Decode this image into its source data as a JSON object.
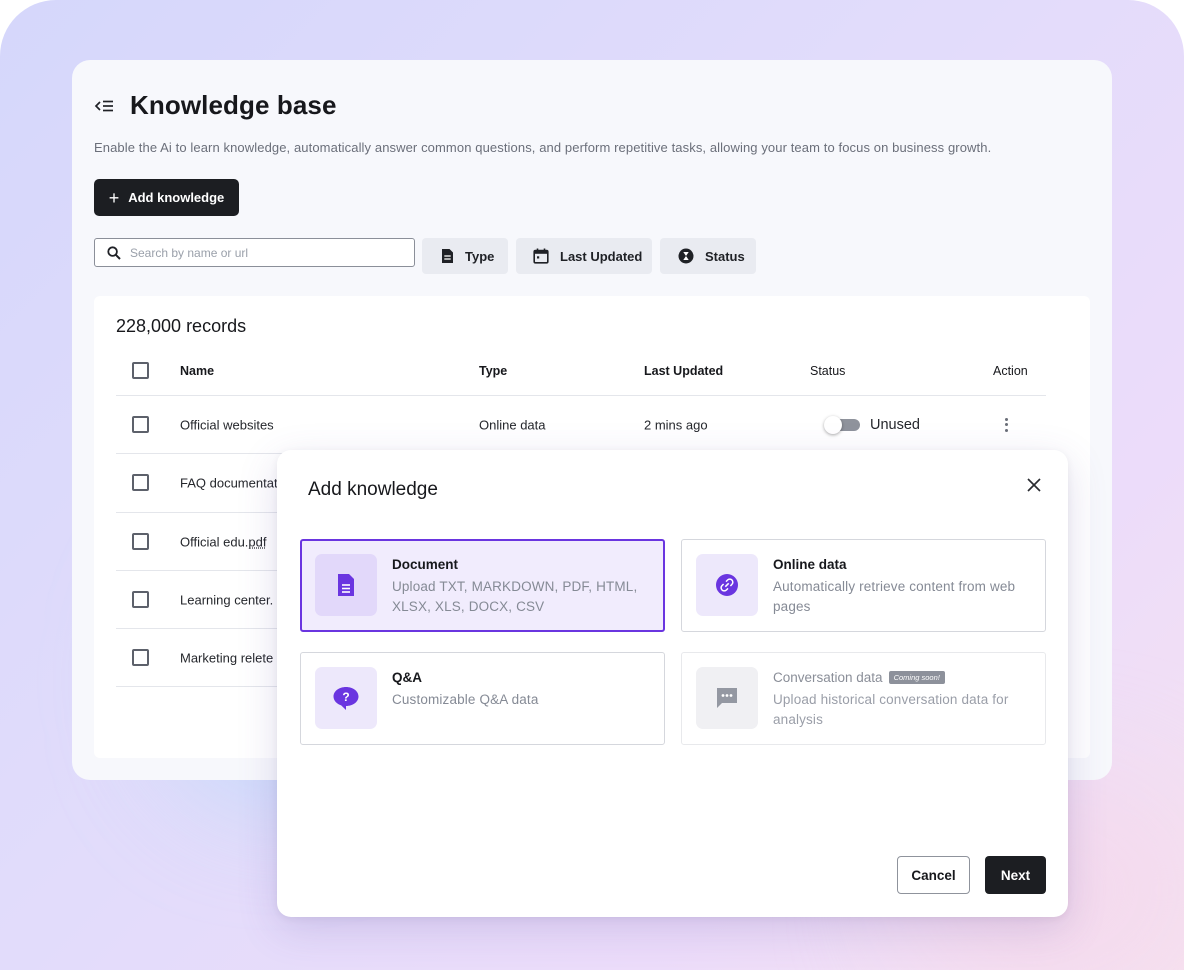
{
  "page": {
    "title": "Knowledge base",
    "subtitle": "Enable the Ai to learn knowledge, automatically answer common questions, and perform repetitive tasks, allowing your team to focus on business growth.",
    "add_button": "Add knowledge"
  },
  "search": {
    "placeholder": "Search by name or url"
  },
  "filters": {
    "type": "Type",
    "last_updated": "Last Updated",
    "status": "Status"
  },
  "table": {
    "records": "228,000 records",
    "headers": {
      "name": "Name",
      "type": "Type",
      "updated": "Last Updated",
      "status": "Status",
      "action": "Action"
    },
    "rows": [
      {
        "name": "Official websites",
        "type": "Online data",
        "updated": "2 mins ago",
        "status": "Unused"
      },
      {
        "name": "FAQ documentat"
      },
      {
        "name_prefix": "Official edu.",
        "name_ext": "pdf"
      },
      {
        "name_prefix": "Learning center.",
        "name_ext": ""
      },
      {
        "name": "Marketing relete"
      }
    ]
  },
  "modal": {
    "title": "Add knowledge",
    "options": [
      {
        "title": "Document",
        "desc": "Upload TXT, MARKDOWN, PDF, HTML, XLSX, XLS, DOCX, CSV",
        "icon": "document-icon",
        "selected": true
      },
      {
        "title": "Online data",
        "desc": "Automatically retrieve content from web pages",
        "icon": "link-icon"
      },
      {
        "title": "Q&A",
        "desc": "Customizable Q&A data",
        "icon": "question-icon"
      },
      {
        "title": "Conversation data",
        "badge": "Coming soon!",
        "desc": "Upload historical conversation data for analysis",
        "icon": "chat-icon",
        "disabled": true
      }
    ],
    "cancel": "Cancel",
    "next": "Next"
  },
  "colors": {
    "accent": "#6a35e0",
    "dark_button": "#1c1e22",
    "selected_bg": "#f1ecfd"
  }
}
